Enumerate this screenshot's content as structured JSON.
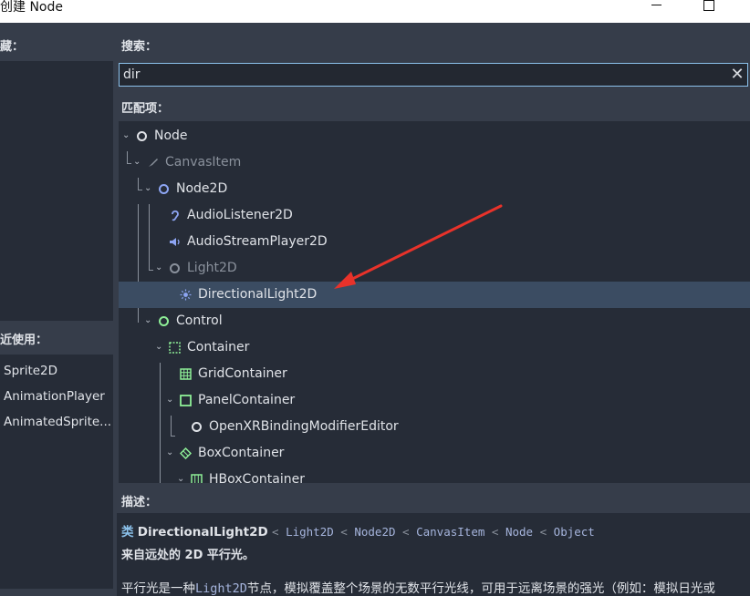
{
  "window": {
    "title": "创建 Node"
  },
  "left": {
    "favorites_label": "藏：",
    "recent_label": "近使用：",
    "recent_items": [
      "Sprite2D",
      "AnimationPlayer",
      "AnimatedSprite..."
    ]
  },
  "search": {
    "label": "搜索：",
    "value": "dir"
  },
  "matches_label": "匹配项：",
  "tree": [
    {
      "label": "Node",
      "icon": "node-circle-icon",
      "dim": false
    },
    {
      "label": "CanvasItem",
      "icon": "brush-icon",
      "dim": true
    },
    {
      "label": "Node2D",
      "icon": "node2d-circle-icon",
      "dim": false
    },
    {
      "label": "AudioListener2D",
      "icon": "ear-icon",
      "dim": false
    },
    {
      "label": "AudioStreamPlayer2D",
      "icon": "speaker-icon",
      "dim": false
    },
    {
      "label": "Light2D",
      "icon": "light2d-circle-icon",
      "dim": true
    },
    {
      "label": "DirectionalLight2D",
      "icon": "sun-icon",
      "dim": false,
      "selected": true
    },
    {
      "label": "Control",
      "icon": "control-circle-icon",
      "dim": false
    },
    {
      "label": "Container",
      "icon": "container-icon",
      "dim": false
    },
    {
      "label": "GridContainer",
      "icon": "grid-icon",
      "dim": false
    },
    {
      "label": "PanelContainer",
      "icon": "panel-icon",
      "dim": false
    },
    {
      "label": "OpenXRBindingModifierEditor",
      "icon": "node-circle-icon",
      "dim": false
    },
    {
      "label": "BoxContainer",
      "icon": "box-container-icon",
      "dim": false
    },
    {
      "label": "HBoxContainer",
      "icon": "hbox-icon",
      "dim": false
    }
  ],
  "description": {
    "label": "描述：",
    "class_keyword": "类",
    "class_name": "DirectionalLight2D",
    "inheritance": [
      "Light2D",
      "Node2D",
      "CanvasItem",
      "Node",
      "Object"
    ],
    "inheritance_sep": "<",
    "brief": "来自远处的 2D 平行光。",
    "body_prefix": "平行光是一种",
    "body_code": "Light2D",
    "body_suffix": "节点，模拟覆盖整个场景的无数平行光线，可用于远离场景的强光（例如：模拟日光或"
  },
  "colors": {
    "selected_row": "#3b4c62",
    "focus_border": "#8cc2ec",
    "annotation_arrow": "#e8322a",
    "node_green": "#8eef97",
    "node_blue": "#8da5f3"
  }
}
